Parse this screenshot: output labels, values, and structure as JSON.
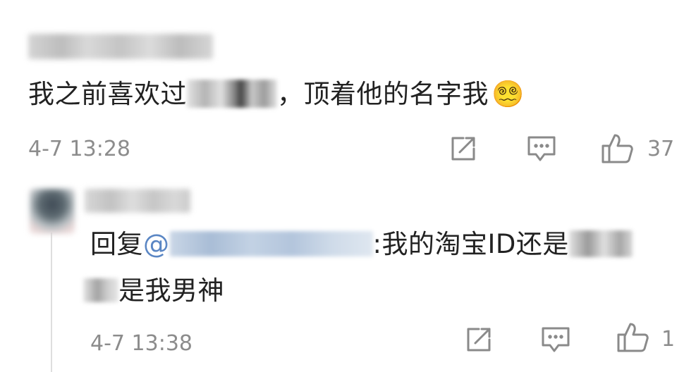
{
  "comments": [
    {
      "username": "",
      "text_before": "我之前喜欢过",
      "text_after": "，顶着他的名字我",
      "emoji": "😵‍💫",
      "time": "4-7 13:28",
      "likes": "37"
    },
    {
      "username": "",
      "reply_prefix": "回复",
      "mention_at": "@",
      "text_mid": ":我的淘宝ID还是",
      "text_line2": "是我男神",
      "time": "4-7 13:38",
      "likes": "1"
    }
  ],
  "icons": {
    "share": "share-icon",
    "comment": "comment-icon",
    "like": "thumbs-up-icon"
  },
  "colors": {
    "text": "#222222",
    "meta": "#8c8c8c",
    "mention": "#5a86c4"
  }
}
